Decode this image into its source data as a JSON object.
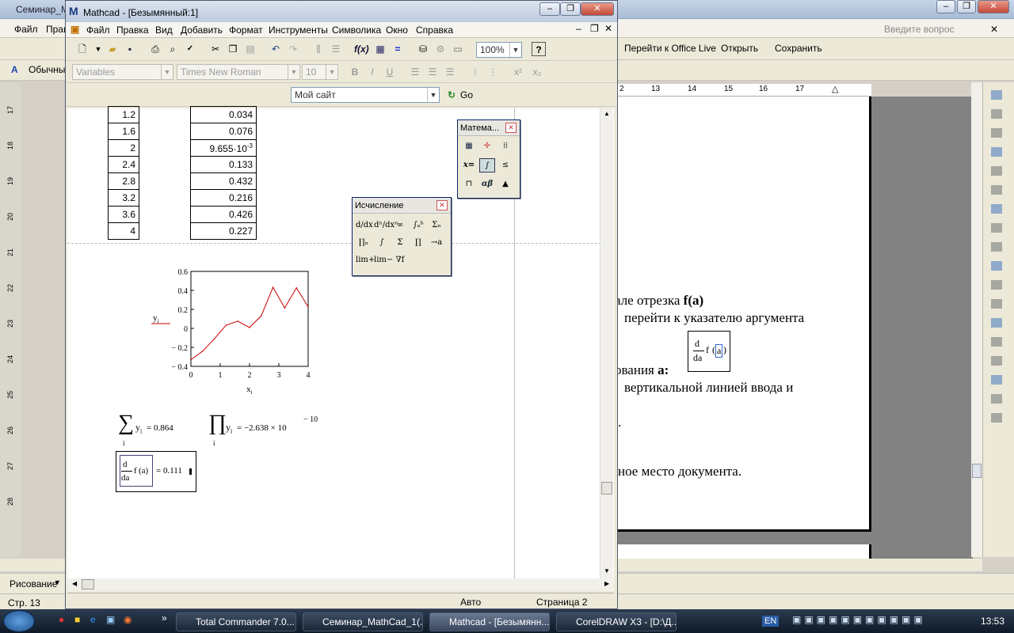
{
  "word": {
    "title": "Семинар_Ма",
    "menu": [
      "Файл",
      "Прав"
    ],
    "style_box": "Обычный",
    "search_placeholder": "Введите вопрос",
    "office_live": "Перейти к Office Live",
    "open": "Открыть",
    "save": "Сохранить",
    "ruler_h": [
      "2",
      "13",
      "14",
      "15",
      "16",
      "17"
    ],
    "ruler_v": [
      "17",
      "18",
      "19",
      "20",
      "21",
      "22",
      "23",
      "24",
      "25",
      "26",
      "27",
      "28"
    ],
    "text": {
      "line1a": "але отрезка ",
      "line1b": "f(a)",
      "line2": "перейти  к  указателю  аргумента",
      "line3a": "ования ",
      "line3b": "a:",
      "line4": "вертикальной  линией  ввода  и",
      "line5": ".",
      "line6": "ное место документа."
    },
    "deriv_box": {
      "num": "d",
      "den": "da",
      "fn": "f",
      "arg": "a"
    },
    "draw_label": "Рисование",
    "status": "Стр. 13"
  },
  "mathcad": {
    "outer_title": "Mathcad - [Безымянный:1]",
    "menu": [
      "Файл",
      "Правка",
      "Вид",
      "Добавить",
      "Формат",
      "Инструменты",
      "Символика",
      "Окно",
      "Справка"
    ],
    "zoom": "100%",
    "var_combo": "Variables",
    "font_combo": "Times New Roman",
    "size_combo": "10",
    "site_combo": "Мой сайт",
    "go_label": "Go",
    "x_table": [
      "1.2",
      "1.6",
      "2",
      "2.4",
      "2.8",
      "3.2",
      "3.6",
      "4"
    ],
    "y_table": [
      "0.034",
      "0.076",
      "9.655·10",
      "0.133",
      "0.432",
      "0.216",
      "0.426",
      "0.227"
    ],
    "y_table_exp": "-3",
    "sum": {
      "var": "y",
      "sub": "i",
      "result": "= 0.864",
      "index": "i"
    },
    "prod": {
      "var": "y",
      "sub": "i",
      "result": "= −2.638 × 10",
      "exp": "− 10",
      "index": "i"
    },
    "deriv": {
      "num": "d",
      "den": "da",
      "fn": "f",
      "arg": "(a)",
      "result": "= 0.111"
    },
    "status_auto": "Авто",
    "status_page": "Страница 2",
    "palette_math_title": "Матема...",
    "palette_calc_title": "Исчисление",
    "calc_buttons": [
      "d/dx",
      "dⁿ/dxⁿ",
      "∞",
      "∫ₐᵇ",
      "Σₙ",
      "∏ₙ",
      "∫",
      "Σ",
      "∏",
      "→a",
      "lim+",
      "lim−",
      "∇f"
    ],
    "math_buttons": [
      "calculator-icon",
      "graph-icon",
      "matrix-icon",
      "x=",
      "calculus-icon",
      "boolean-icon",
      "programming-icon",
      "αβ",
      "symbolic-icon"
    ]
  },
  "chart_data": {
    "type": "line",
    "x": [
      0,
      0.4,
      0.8,
      1.2,
      1.6,
      2.0,
      2.4,
      2.8,
      3.2,
      3.6,
      4.0
    ],
    "series": [
      {
        "name": "y",
        "values": [
          -0.33,
          -0.24,
          -0.11,
          0.034,
          0.076,
          0.009655,
          0.133,
          0.432,
          0.216,
          0.426,
          0.227
        ],
        "color": "#cc0000"
      }
    ],
    "xlabel": "x",
    "xlabel_sub": "i",
    "ylabel": "y",
    "ylabel_sub": "i",
    "xlim": [
      0,
      4
    ],
    "ylim": [
      -0.4,
      0.6
    ],
    "xticks": [
      "0",
      "1",
      "2",
      "3",
      "4"
    ],
    "yticks": [
      "0.6",
      "0.4",
      "0.2",
      "0",
      "− 0.2",
      "− 0.4"
    ],
    "grid": false
  },
  "taskbar": {
    "tasks": [
      "Total Commander 7.0...",
      "Семинар_MathCad_1(...",
      "Mathcad - [Безымянн...",
      "CorelDRAW X3 - [D:\\Д..."
    ],
    "lang": "EN",
    "clock": "13:53"
  },
  "colors": {
    "accent": "#0a246a",
    "plot": "#cc0000"
  }
}
